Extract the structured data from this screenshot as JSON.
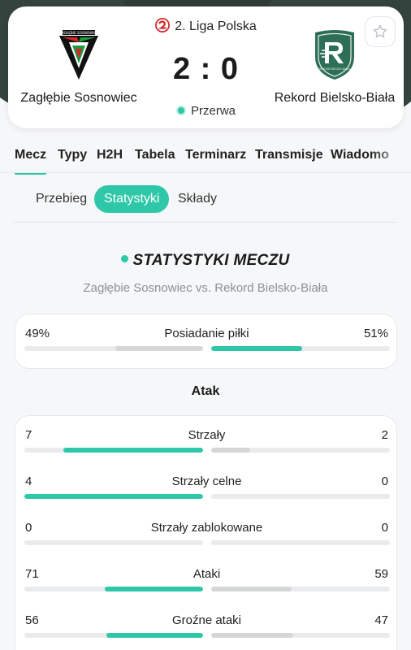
{
  "match": {
    "league": "2. Liga Polska",
    "home_team": "Zagłębie Sosnowiec",
    "away_team": "Rekord Bielsko-Biała",
    "score": "2 : 0",
    "status": "Przerwa",
    "home_logo_text": "ZAGŁĘBIE SOSNOWIEC",
    "away_logo_text": "REKORD BIELSKO-BIAŁA",
    "colors": {
      "accent": "#2ec8a8",
      "header_bg": "#2f3b37"
    }
  },
  "tabs": [
    "Mecz",
    "Typy",
    "H2H",
    "Tabela",
    "Terminarz",
    "Transmisje",
    "Wiadomo"
  ],
  "subtabs": [
    "Przebieg",
    "Statystyki",
    "Składy"
  ],
  "stats": {
    "title": "STATYSTYKI MECZU",
    "subtitle": "Zagłębie Sosnowiec vs. Rekord Bielsko-Biała",
    "possession": {
      "label": "Posiadanie piłki",
      "home": "49%",
      "away": "51%",
      "home_frac": 0.49,
      "away_frac": 0.51,
      "leader": "away"
    },
    "attack_heading": "Atak",
    "attack": [
      {
        "label": "Strzały",
        "home": "7",
        "away": "2",
        "home_frac": 0.78,
        "away_frac": 0.22,
        "leader": "home"
      },
      {
        "label": "Strzały celne",
        "home": "4",
        "away": "0",
        "home_frac": 1.0,
        "away_frac": 0.0,
        "leader": "home"
      },
      {
        "label": "Strzały zablokowane",
        "home": "0",
        "away": "0",
        "home_frac": 0.0,
        "away_frac": 0.0,
        "leader": "none"
      },
      {
        "label": "Ataki",
        "home": "71",
        "away": "59",
        "home_frac": 0.55,
        "away_frac": 0.45,
        "leader": "home"
      },
      {
        "label": "Groźne ataki",
        "home": "56",
        "away": "47",
        "home_frac": 0.54,
        "away_frac": 0.46,
        "leader": "home"
      }
    ]
  }
}
